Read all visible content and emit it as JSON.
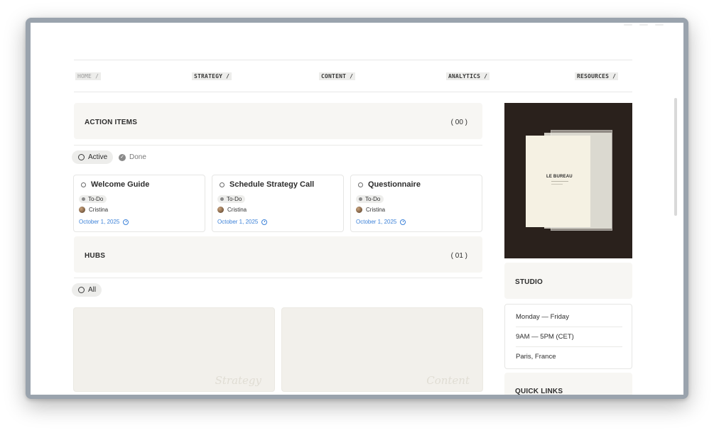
{
  "nav": {
    "home": "HOME /",
    "strategy": "STRATEGY /",
    "content": "CONTENT /",
    "analytics": "ANALYTICS /",
    "resources": "RESOURCES /"
  },
  "action_items": {
    "title": "ACTION ITEMS",
    "count": "( 00 )",
    "filters": {
      "active": "Active",
      "done": "Done"
    },
    "cards": [
      {
        "title": "Welcome Guide",
        "status": "To-Do",
        "assignee": "Cristina",
        "date": "October 1, 2025"
      },
      {
        "title": "Schedule Strategy Call",
        "status": "To-Do",
        "assignee": "Cristina",
        "date": "October 1, 2025"
      },
      {
        "title": "Questionnaire",
        "status": "To-Do",
        "assignee": "Cristina",
        "date": "October 1, 2025"
      }
    ]
  },
  "hubs": {
    "title": "HUBS",
    "count": "( 01 )",
    "filter_all": "All",
    "items": [
      {
        "title": "Strategy"
      },
      {
        "title": "Content"
      }
    ]
  },
  "sidebar": {
    "image_logo": "LE BUREAU",
    "studio_title": "STUDIO",
    "days": "Monday — Friday",
    "hours": "9AM — 5PM (CET)",
    "location": "Paris, France",
    "quick_links_title": "QUICK LINKS"
  },
  "colors": {
    "link_blue": "#3d82d8",
    "panel_bg": "#f7f6f3",
    "pill_bg": "#ededeb"
  }
}
